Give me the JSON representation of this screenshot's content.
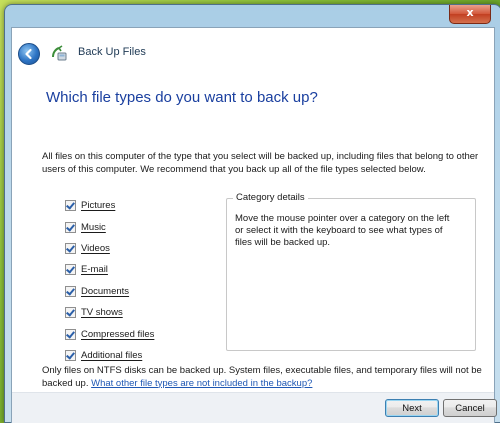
{
  "window": {
    "close_symbol": "x",
    "title": "Back Up Files"
  },
  "icons": {
    "back": "back-arrow-icon",
    "app": "backup-app-icon"
  },
  "page": {
    "heading": "Which file types do you want to back up?",
    "description": "All files on this computer of the type that you select will be backed up, including files that belong to other users of this computer. We recommend that you back up all of the file types selected below."
  },
  "file_types": [
    {
      "label": "Pictures",
      "checked": true
    },
    {
      "label": "Music",
      "checked": true
    },
    {
      "label": "Videos",
      "checked": true
    },
    {
      "label": "E-mail",
      "checked": true
    },
    {
      "label": "Documents",
      "checked": true
    },
    {
      "label": "TV shows",
      "checked": true
    },
    {
      "label": "Compressed files",
      "checked": true
    },
    {
      "label": "Additional files",
      "checked": true
    }
  ],
  "category_details": {
    "legend": "Category details",
    "text": "Move the mouse pointer over a category on the left or select it with the keyboard to see what types of files will be backed up."
  },
  "footer": {
    "note": "Only files on NTFS disks can be backed up. System files, executable files, and temporary files will not be backed up.",
    "link": "What other file types are not included in the backup?"
  },
  "buttons": {
    "next": "Next",
    "cancel": "Cancel"
  },
  "colors": {
    "heading": "#1a3f9f",
    "link": "#1f58b4",
    "desktop": "#7fae2c"
  }
}
